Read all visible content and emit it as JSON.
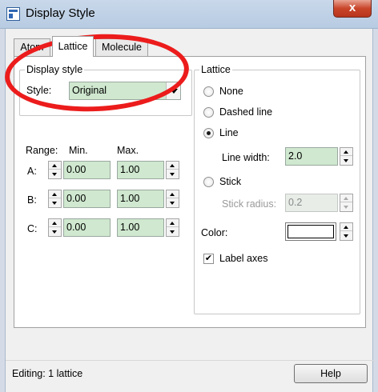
{
  "window": {
    "title": "Display Style",
    "close_label": "x"
  },
  "tabs": [
    {
      "label": "Atom",
      "active": false
    },
    {
      "label": "Lattice",
      "active": true
    },
    {
      "label": "Molecule",
      "active": false
    }
  ],
  "display_style": {
    "legend": "Display style",
    "style_label": "Style:",
    "style_value": "Original",
    "range_label": "Range:",
    "min_label": "Min.",
    "max_label": "Max.",
    "rows": [
      {
        "label": "A:",
        "min": "0.00",
        "max": "1.00"
      },
      {
        "label": "B:",
        "min": "0.00",
        "max": "1.00"
      },
      {
        "label": "C:",
        "min": "0.00",
        "max": "1.00"
      }
    ]
  },
  "lattice": {
    "legend": "Lattice",
    "options": [
      {
        "label": "None",
        "checked": false
      },
      {
        "label": "Dashed line",
        "checked": false
      },
      {
        "label": "Line",
        "checked": true
      },
      {
        "label": "Stick",
        "checked": false
      }
    ],
    "line_width_label": "Line width:",
    "line_width_value": "2.0",
    "stick_radius_label": "Stick radius:",
    "stick_radius_value": "0.2",
    "color_label": "Color:",
    "color_value": "#ffffff",
    "label_axes": "Label axes",
    "label_axes_checked": true
  },
  "status": {
    "text": "Editing: 1 lattice"
  },
  "help_button": {
    "label": "Help"
  },
  "annotation": {
    "color": "#ec1c1c"
  }
}
